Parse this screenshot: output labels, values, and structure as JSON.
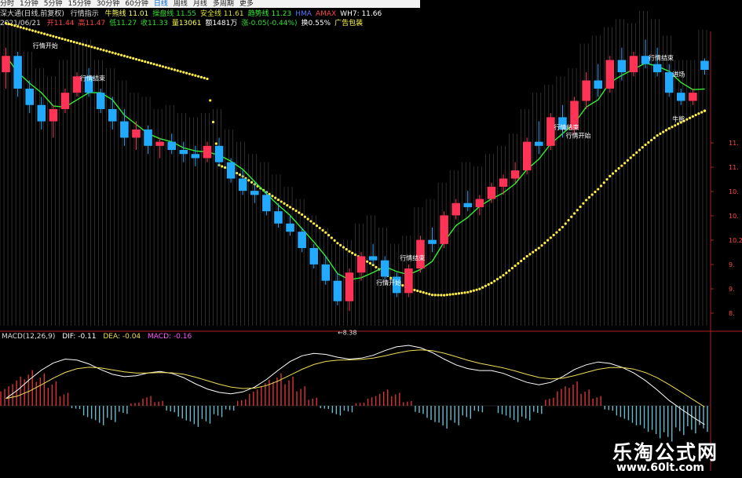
{
  "toolbar": {
    "periods": [
      "分时",
      "1分钟",
      "5分钟",
      "15分钟",
      "30分钟",
      "60分钟",
      "日线",
      "周线",
      "月线",
      "多周期",
      "更多"
    ]
  },
  "header": {
    "title": "深大通(日线,前复权)",
    "indicator_name": "行情指示",
    "items": [
      {
        "text": "牛熊线 11.01",
        "color": "#ffff55"
      },
      {
        "text": "操盘线 11.55",
        "color": "#33dd33"
      },
      {
        "text": "安全线 11.61",
        "color": "#dddd33"
      },
      {
        "text": "趋势线 11.23",
        "color": "#33ee33"
      },
      {
        "text": "HMA",
        "color": "#5577ff"
      },
      {
        "text": "AMAX",
        "color": "#ff4444"
      },
      {
        "text": "WH7: 11.66",
        "color": "#ffffff"
      }
    ],
    "date": "2021/06/21",
    "quote": [
      {
        "text": "开11.44",
        "color": "#ff4444"
      },
      {
        "text": "高11.47",
        "color": "#ff4444"
      },
      {
        "text": "低11.27",
        "color": "#33dd33"
      },
      {
        "text": "收11.33",
        "color": "#33dd33"
      },
      {
        "text": "量13061",
        "color": "#ffff55"
      },
      {
        "text": "额1481万",
        "color": "#ffffff"
      },
      {
        "text": "涨-0.05(-0.44%)",
        "color": "#33dd33"
      },
      {
        "text": "换0.55%",
        "color": "#ffffff"
      },
      {
        "text": "广告包装",
        "color": "#ffff55"
      }
    ]
  },
  "price_axis": [
    "11.",
    "11.",
    "10.",
    "10.",
    "10.2",
    "9.",
    "9.",
    "8."
  ],
  "annotations": {
    "low_label": "←8.38",
    "signals": [
      "行情开始",
      "行情结束",
      "行情结束",
      "行情开始",
      "行情结束",
      "行情开始",
      "行情结束",
      "进场",
      "牛熊"
    ]
  },
  "macd": {
    "legend_name": "MACD(12,26,9)",
    "dif": "DIF: -0.11",
    "dea": "DEA: -0.04",
    "macd": "MACD: -0.16"
  },
  "watermark": {
    "name": "乐淘公式网",
    "url": "www.60lt.com"
  },
  "colors": {
    "up": "#ff3355",
    "down": "#22aaff",
    "bull_bear_line": "#ffee44",
    "trend_line": "#33ee33",
    "dif_line": "#ffffff",
    "dea_line": "#eedd55",
    "macd_pos": "#dd3333",
    "macd_neg": "#66bbcc"
  },
  "chart_data": {
    "type": "candlestick",
    "title": "深大通(日线,前复权)",
    "ylim": [
      8.2,
      11.8
    ],
    "candles": [
      [
        11.3,
        11.6,
        11.1,
        11.5
      ],
      [
        11.5,
        11.55,
        11.0,
        11.1
      ],
      [
        11.1,
        11.2,
        10.8,
        10.9
      ],
      [
        10.9,
        11.0,
        10.6,
        10.7
      ],
      [
        10.7,
        10.9,
        10.5,
        10.85
      ],
      [
        10.85,
        11.1,
        10.8,
        11.05
      ],
      [
        11.05,
        11.3,
        11.0,
        11.25
      ],
      [
        11.25,
        11.35,
        11.0,
        11.05
      ],
      [
        11.05,
        11.1,
        10.8,
        10.85
      ],
      [
        10.85,
        11.0,
        10.6,
        10.7
      ],
      [
        10.7,
        10.85,
        10.4,
        10.5
      ],
      [
        10.5,
        10.7,
        10.35,
        10.6
      ],
      [
        10.6,
        10.65,
        10.3,
        10.4
      ],
      [
        10.4,
        10.5,
        10.25,
        10.45
      ],
      [
        10.45,
        10.55,
        10.3,
        10.35
      ],
      [
        10.35,
        10.45,
        10.2,
        10.3
      ],
      [
        10.3,
        10.4,
        10.15,
        10.25
      ],
      [
        10.25,
        10.45,
        10.2,
        10.4
      ],
      [
        10.4,
        10.5,
        10.15,
        10.2
      ],
      [
        10.2,
        10.25,
        9.95,
        10.0
      ],
      [
        10.0,
        10.1,
        9.8,
        9.85
      ],
      [
        9.85,
        9.95,
        9.7,
        9.8
      ],
      [
        9.8,
        9.85,
        9.55,
        9.6
      ],
      [
        9.6,
        9.7,
        9.4,
        9.45
      ],
      [
        9.45,
        9.55,
        9.3,
        9.35
      ],
      [
        9.35,
        9.4,
        9.1,
        9.15
      ],
      [
        9.15,
        9.2,
        8.9,
        8.95
      ],
      [
        8.95,
        9.05,
        8.7,
        8.75
      ],
      [
        8.75,
        8.85,
        8.45,
        8.5
      ],
      [
        8.5,
        8.9,
        8.38,
        8.85
      ],
      [
        8.85,
        9.1,
        8.75,
        9.05
      ],
      [
        9.05,
        9.2,
        8.95,
        9.0
      ],
      [
        9.0,
        9.05,
        8.75,
        8.8
      ],
      [
        8.8,
        8.85,
        8.55,
        8.6
      ],
      [
        8.6,
        8.95,
        8.55,
        8.9
      ],
      [
        8.9,
        9.3,
        8.85,
        9.25
      ],
      [
        9.25,
        9.4,
        9.1,
        9.2
      ],
      [
        9.2,
        9.6,
        9.15,
        9.55
      ],
      [
        9.55,
        9.75,
        9.5,
        9.7
      ],
      [
        9.7,
        9.85,
        9.6,
        9.65
      ],
      [
        9.65,
        9.8,
        9.55,
        9.75
      ],
      [
        9.75,
        9.95,
        9.7,
        9.9
      ],
      [
        9.9,
        10.05,
        9.8,
        10.0
      ],
      [
        10.0,
        10.2,
        9.95,
        10.1
      ],
      [
        10.1,
        10.5,
        10.05,
        10.45
      ],
      [
        10.45,
        10.7,
        10.3,
        10.4
      ],
      [
        10.4,
        10.8,
        10.35,
        10.75
      ],
      [
        10.75,
        10.9,
        10.5,
        10.6
      ],
      [
        10.6,
        11.0,
        10.55,
        10.95
      ],
      [
        10.95,
        11.3,
        10.85,
        11.2
      ],
      [
        11.2,
        11.4,
        11.0,
        11.1
      ],
      [
        11.1,
        11.5,
        11.05,
        11.45
      ],
      [
        11.45,
        11.6,
        11.2,
        11.3
      ],
      [
        11.3,
        11.55,
        11.25,
        11.5
      ],
      [
        11.5,
        11.7,
        11.35,
        11.4
      ],
      [
        11.4,
        11.6,
        11.25,
        11.3
      ],
      [
        11.3,
        11.4,
        11.0,
        11.05
      ],
      [
        11.05,
        11.1,
        10.9,
        10.95
      ],
      [
        10.95,
        11.1,
        10.9,
        11.05
      ],
      [
        11.44,
        11.47,
        11.27,
        11.33
      ]
    ],
    "macd_hist": [
      0.12,
      0.18,
      0.22,
      0.2,
      0.15,
      0.08,
      -0.02,
      -0.08,
      -0.12,
      -0.1,
      -0.05,
      0.02,
      0.06,
      0.03,
      -0.04,
      -0.09,
      -0.13,
      -0.11,
      -0.07,
      -0.03,
      0.04,
      0.1,
      0.16,
      0.2,
      0.18,
      0.12,
      0.05,
      -0.02,
      -0.06,
      -0.04,
      0.02,
      0.06,
      0.1,
      0.08,
      0.03,
      -0.05,
      -0.1,
      -0.14,
      -0.12,
      -0.08,
      -0.04,
      0.0,
      -0.06,
      -0.1,
      -0.09,
      -0.05,
      0.05,
      0.12,
      0.15,
      0.1,
      0.06,
      -0.03,
      -0.08,
      -0.12,
      -0.16,
      -0.2,
      -0.22,
      -0.18,
      -0.17,
      -0.16
    ]
  }
}
